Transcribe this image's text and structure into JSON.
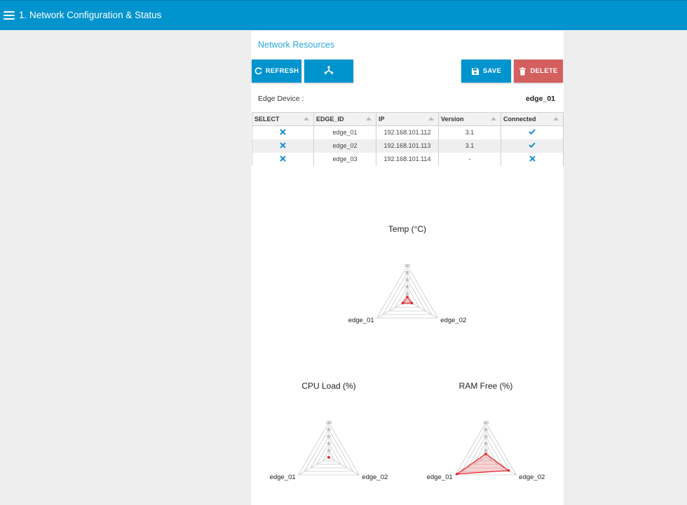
{
  "header": {
    "title": "1. Network Configuration & Status"
  },
  "group": {
    "title": "Network Resources"
  },
  "toolbar": {
    "refresh_label": "REFRESH",
    "save_label": "SAVE",
    "delete_label": "DELETE"
  },
  "edge_device": {
    "label": "Edge Device :",
    "value": "edge_01"
  },
  "table": {
    "columns": [
      "SELECT",
      "EDGE_ID",
      "IP",
      "Version",
      "Connected"
    ],
    "rows": [
      {
        "edge_id": "edge_01",
        "ip": "192.168.101.112",
        "version": "3.1",
        "connected": true
      },
      {
        "edge_id": "edge_02",
        "ip": "192.168.101.113",
        "version": "3.1",
        "connected": true
      },
      {
        "edge_id": "edge_03",
        "ip": "192.168.101.114",
        "version": "-",
        "connected": false
      }
    ]
  },
  "colors": {
    "accent": "#0094ce",
    "danger": "#d45f5f",
    "series": "#e8232a"
  },
  "chart_data": [
    {
      "type": "radar",
      "title": "Temp (°C)",
      "axes": [
        "",
        "edge_02",
        "edge_01"
      ],
      "ticks": [
        "100",
        "80",
        "60",
        "40",
        "20"
      ],
      "range": [
        0,
        100
      ],
      "values": [
        10,
        15,
        15
      ]
    },
    {
      "type": "radar",
      "title": "CPU Load (%)",
      "axes": [
        "",
        "edge_02",
        "edge_01"
      ],
      "ticks": [
        "100",
        "80",
        "60",
        "40",
        "20"
      ],
      "range": [
        0,
        100
      ],
      "values": [
        0,
        0,
        0
      ]
    },
    {
      "type": "radar",
      "title": "RAM Free (%)",
      "axes": [
        "",
        "edge_02",
        "edge_01"
      ],
      "ticks": [
        "100",
        "80",
        "60",
        "40",
        "20"
      ],
      "range": [
        0,
        100
      ],
      "values": [
        10,
        75,
        95
      ]
    }
  ]
}
